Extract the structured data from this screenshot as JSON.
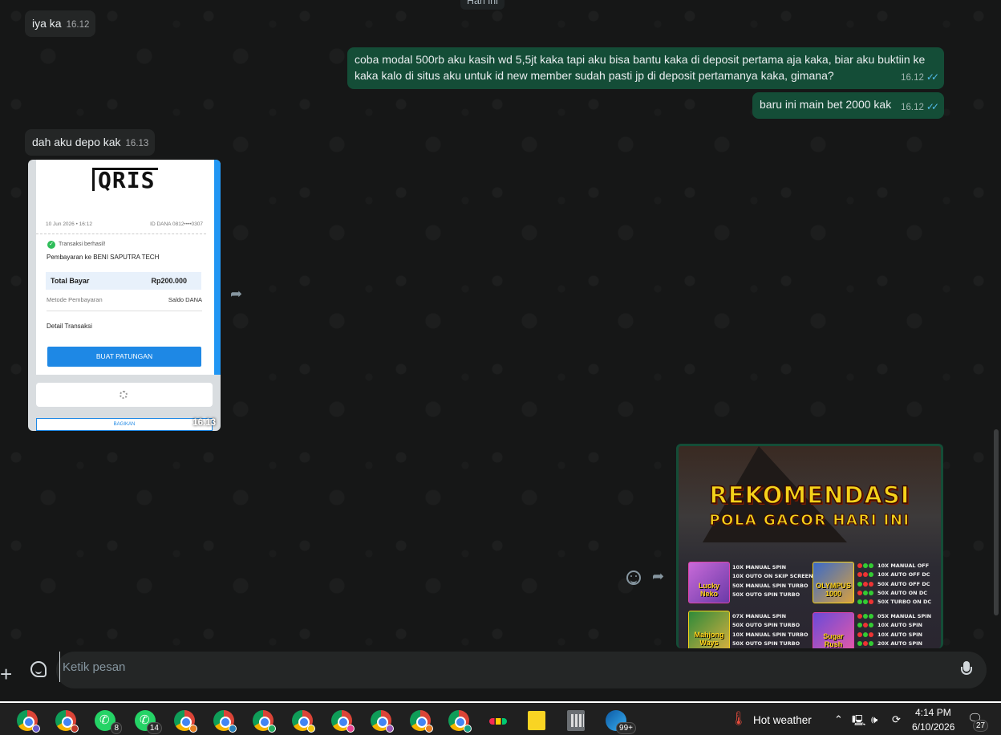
{
  "chat": {
    "date_chip": "Hari ini",
    "messages": [
      {
        "dir": "in",
        "text": "iya ka",
        "time": "16.12"
      },
      {
        "dir": "out",
        "text": "coba modal 500rb aku kasih wd 5,5jt kaka tapi aku bisa bantu kaka di deposit pertama aja kaka, biar aku buktiin ke kaka kalo di situs aku untuk id new member sudah pasti jp di deposit pertamanya kaka, gimana?",
        "time": "16.12"
      },
      {
        "dir": "out",
        "text": "baru ini main bet 2000 kak",
        "time": "16.12"
      },
      {
        "dir": "in",
        "text": "dah aku depo kak",
        "time": "16.13"
      }
    ],
    "receipt_image": {
      "logo": "QRIS",
      "date": "10 Jun 2026 • 16:12",
      "account": "ID DANA 0812••••0307",
      "status": "Transaksi berhasil!",
      "merchant": "Pembayaran ke BENI SAPUTRA TECH",
      "total_label": "Total Bayar",
      "total_value": "Rp200.000",
      "method_label": "Metode Pembayaran",
      "method_value": "Saldo DANA",
      "detail_label": "Detail Transaksi",
      "button_label": "BUAT PATUNGAN",
      "share_label": "BAGIKAN",
      "time": "16.13"
    },
    "promo_image": {
      "title": "REKOMENDASI",
      "subtitle": "POLA GACOR HARI INI",
      "games": [
        {
          "name": "Lucky Neko",
          "lines": [
            "10X MANUAL SPIN",
            "10X OUTO ON SKIP SCREENS",
            "50X MANUAL SPIN TURBO",
            "50X OUTO SPIN TURBO"
          ]
        },
        {
          "name": "OLYMPUS 1000",
          "lines": [
            "10X MANUAL OFF",
            "10X AUTO OFF DC",
            "50X AUTO OFF DC",
            "50X AUTO ON DC",
            "50X TURBO ON DC"
          ]
        },
        {
          "name": "Mahjong Ways",
          "lines": [
            "07X MANUAL SPIN",
            "50X OUTO SPIN TURBO",
            "10X MANUAL SPIN TURBO",
            "50X OUTO SPIN TURBO"
          ]
        },
        {
          "name": "Sugar Rush",
          "lines": [
            "05X MANUAL SPIN",
            "10X AUTO SPIN",
            "10X AUTO SPIN",
            "20X AUTO SPIN"
          ]
        }
      ]
    }
  },
  "composer": {
    "placeholder": "Ketik pesan"
  },
  "taskbar": {
    "badges": {
      "wa1": "8",
      "wa2": "14",
      "edge": "99+",
      "notif": "27"
    },
    "weather": "Hot weather",
    "time": "4:14 PM",
    "date": "6/10/2026"
  }
}
